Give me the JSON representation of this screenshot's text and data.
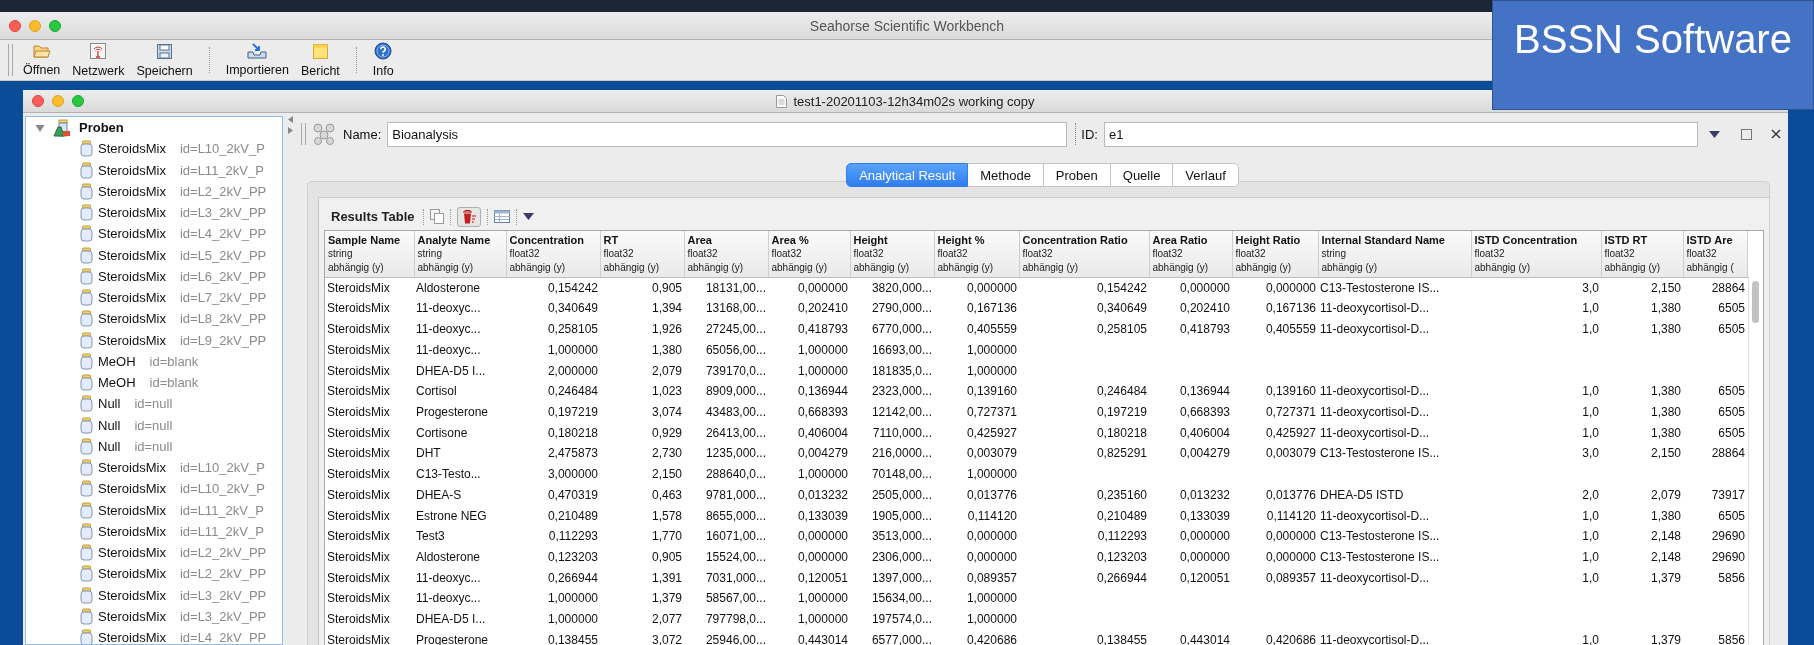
{
  "window": {
    "title": "Seahorse Scientific Workbench"
  },
  "toolbar": {
    "groups": [
      [
        {
          "label": "Öffnen",
          "kind": "folder"
        },
        {
          "label": "Netzwerk",
          "kind": "antenna"
        },
        {
          "label": "Speichern",
          "kind": "floppy"
        }
      ],
      [
        {
          "label": "Importieren",
          "kind": "import"
        },
        {
          "label": "Bericht",
          "kind": "note"
        }
      ],
      [
        {
          "label": "Info",
          "kind": "help"
        }
      ]
    ]
  },
  "document": {
    "title": "test1-20201103-12h34m02s working copy"
  },
  "tree": {
    "label": "Proben",
    "expanded": true,
    "children": [
      {
        "name": "SteroidsMix",
        "id": "id=L10_2kV_P"
      },
      {
        "name": "SteroidsMix",
        "id": "id=L11_2kV_P"
      },
      {
        "name": "SteroidsMix",
        "id": "id=L2_2kV_PP"
      },
      {
        "name": "SteroidsMix",
        "id": "id=L3_2kV_PP"
      },
      {
        "name": "SteroidsMix",
        "id": "id=L4_2kV_PP"
      },
      {
        "name": "SteroidsMix",
        "id": "id=L5_2kV_PP"
      },
      {
        "name": "SteroidsMix",
        "id": "id=L6_2kV_PP"
      },
      {
        "name": "SteroidsMix",
        "id": "id=L7_2kV_PP"
      },
      {
        "name": "SteroidsMix",
        "id": "id=L8_2kV_PP"
      },
      {
        "name": "SteroidsMix",
        "id": "id=L9_2kV_PP"
      },
      {
        "name": "MeOH",
        "id": "id=blank"
      },
      {
        "name": "MeOH",
        "id": "id=blank"
      },
      {
        "name": "Null",
        "id": "id=null"
      },
      {
        "name": "Null",
        "id": "id=null"
      },
      {
        "name": "Null",
        "id": "id=null"
      },
      {
        "name": "SteroidsMix",
        "id": "id=L10_2kV_P"
      },
      {
        "name": "SteroidsMix",
        "id": "id=L10_2kV_P"
      },
      {
        "name": "SteroidsMix",
        "id": "id=L11_2kV_P"
      },
      {
        "name": "SteroidsMix",
        "id": "id=L11_2kV_P"
      },
      {
        "name": "SteroidsMix",
        "id": "id=L2_2kV_PP"
      },
      {
        "name": "SteroidsMix",
        "id": "id=L2_2kV_PP"
      },
      {
        "name": "SteroidsMix",
        "id": "id=L3_2kV_PP"
      },
      {
        "name": "SteroidsMix",
        "id": "id=L3_2kV_PP"
      },
      {
        "name": "SteroidsMix",
        "id": "id=L4_2kV_PP"
      }
    ]
  },
  "editor": {
    "name_label": "Name:",
    "name_value": "Bioanalysis",
    "id_label": "ID:",
    "id_value": "e1"
  },
  "tabs": [
    {
      "label": "Analytical Result",
      "selected": true
    },
    {
      "label": "Methode",
      "selected": false
    },
    {
      "label": "Proben",
      "selected": false
    },
    {
      "label": "Quelle",
      "selected": false
    },
    {
      "label": "Verlauf",
      "selected": false
    }
  ],
  "results": {
    "title": "Results Table",
    "columns": [
      {
        "name": "Sample Name",
        "type": "string",
        "role": "abhängig (y)"
      },
      {
        "name": "Analyte Name",
        "type": "string",
        "role": "abhängig (y)"
      },
      {
        "name": "Concentration",
        "type": "float32",
        "role": "abhängig (y)"
      },
      {
        "name": "RT",
        "type": "float32",
        "role": "abhängig (y)"
      },
      {
        "name": "Area",
        "type": "float32",
        "role": "abhängig (y)"
      },
      {
        "name": "Area %",
        "type": "float32",
        "role": "abhängig (y)"
      },
      {
        "name": "Height",
        "type": "float32",
        "role": "abhängig (y)"
      },
      {
        "name": "Height %",
        "type": "float32",
        "role": "abhängig (y)"
      },
      {
        "name": "Concentration Ratio",
        "type": "float32",
        "role": "abhängig (y)"
      },
      {
        "name": "Area Ratio",
        "type": "float32",
        "role": "abhängig (y)"
      },
      {
        "name": "Height Ratio",
        "type": "float32",
        "role": "abhängig (y)"
      },
      {
        "name": "Internal Standard Name",
        "type": "string",
        "role": "abhängig (y)"
      },
      {
        "name": "ISTD Concentration",
        "type": "float32",
        "role": "abhängig (y)"
      },
      {
        "name": "ISTD RT",
        "type": "float32",
        "role": "abhängig (y)"
      },
      {
        "name": "ISTD Are",
        "type": "float32",
        "role": "abhängig ("
      }
    ],
    "rows": [
      [
        "SteroidsMix",
        "Aldosterone",
        "0,154242",
        "0,905",
        "18131,00...",
        "0,000000",
        "3820,000...",
        "0,000000",
        "0,154242",
        "0,000000",
        "0,000000",
        "C13-Testosterone IS...",
        "3,0",
        "2,150",
        "28864"
      ],
      [
        "SteroidsMix",
        "11-deoxyc...",
        "0,340649",
        "1,394",
        "13168,00...",
        "0,202410",
        "2790,000...",
        "0,167136",
        "0,340649",
        "0,202410",
        "0,167136",
        "11-deoxycortisol-D...",
        "1,0",
        "1,380",
        "6505"
      ],
      [
        "SteroidsMix",
        "11-deoxyc...",
        "0,258105",
        "1,926",
        "27245,00...",
        "0,418793",
        "6770,000...",
        "0,405559",
        "0,258105",
        "0,418793",
        "0,405559",
        "11-deoxycortisol-D...",
        "1,0",
        "1,380",
        "6505"
      ],
      [
        "SteroidsMix",
        "11-deoxyc...",
        "1,000000",
        "1,380",
        "65056,00...",
        "1,000000",
        "16693,00...",
        "1,000000"
      ],
      [
        "SteroidsMix",
        "DHEA-D5 I...",
        "2,000000",
        "2,079",
        "739170,0...",
        "1,000000",
        "181835,0...",
        "1,000000"
      ],
      [
        "SteroidsMix",
        "Cortisol",
        "0,246484",
        "1,023",
        "8909,000...",
        "0,136944",
        "2323,000...",
        "0,139160",
        "0,246484",
        "0,136944",
        "0,139160",
        "11-deoxycortisol-D...",
        "1,0",
        "1,380",
        "6505"
      ],
      [
        "SteroidsMix",
        "Progesterone",
        "0,197219",
        "3,074",
        "43483,00...",
        "0,668393",
        "12142,00...",
        "0,727371",
        "0,197219",
        "0,668393",
        "0,727371",
        "11-deoxycortisol-D...",
        "1,0",
        "1,380",
        "6505"
      ],
      [
        "SteroidsMix",
        "Cortisone",
        "0,180218",
        "0,929",
        "26413,00...",
        "0,406004",
        "7110,000...",
        "0,425927",
        "0,180218",
        "0,406004",
        "0,425927",
        "11-deoxycortisol-D...",
        "1,0",
        "1,380",
        "6505"
      ],
      [
        "SteroidsMix",
        "DHT",
        "2,475873",
        "2,730",
        "1235,000...",
        "0,004279",
        "216,0000...",
        "0,003079",
        "0,825291",
        "0,004279",
        "0,003079",
        "C13-Testosterone IS...",
        "3,0",
        "2,150",
        "28864"
      ],
      [
        "SteroidsMix",
        "C13-Testo...",
        "3,000000",
        "2,150",
        "288640,0...",
        "1,000000",
        "70148,00...",
        "1,000000"
      ],
      [
        "SteroidsMix",
        "DHEA-S",
        "0,470319",
        "0,463",
        "9781,000...",
        "0,013232",
        "2505,000...",
        "0,013776",
        "0,235160",
        "0,013232",
        "0,013776",
        "DHEA-D5 ISTD",
        "2,0",
        "2,079",
        "73917"
      ],
      [
        "SteroidsMix",
        "Estrone NEG",
        "0,210489",
        "1,578",
        "8655,000...",
        "0,133039",
        "1905,000...",
        "0,114120",
        "0,210489",
        "0,133039",
        "0,114120",
        "11-deoxycortisol-D...",
        "1,0",
        "1,380",
        "6505"
      ],
      [
        "SteroidsMix",
        "Test3",
        "0,112293",
        "1,770",
        "16071,00...",
        "0,000000",
        "3513,000...",
        "0,000000",
        "0,112293",
        "0,000000",
        "0,000000",
        "C13-Testosterone IS...",
        "1,0",
        "2,148",
        "29690"
      ],
      [
        "SteroidsMix",
        "Aldosterone",
        "0,123203",
        "0,905",
        "15524,00...",
        "0,000000",
        "2306,000...",
        "0,000000",
        "0,123203",
        "0,000000",
        "0,000000",
        "C13-Testosterone IS...",
        "1,0",
        "2,148",
        "29690"
      ],
      [
        "SteroidsMix",
        "11-deoxyc...",
        "0,266944",
        "1,391",
        "7031,000...",
        "0,120051",
        "1397,000...",
        "0,089357",
        "0,266944",
        "0,120051",
        "0,089357",
        "11-deoxycortisol-D...",
        "1,0",
        "1,379",
        "5856"
      ],
      [
        "SteroidsMix",
        "11-deoxyc...",
        "1,000000",
        "1,379",
        "58567,00...",
        "1,000000",
        "15634,00...",
        "1,000000"
      ],
      [
        "SteroidsMix",
        "DHEA-D5 I...",
        "1,000000",
        "2,077",
        "797798,0...",
        "1,000000",
        "197574,0...",
        "1,000000"
      ],
      [
        "SteroidsMix",
        "Progesterone",
        "0,138455",
        "3,072",
        "25946,00...",
        "0,443014",
        "6577,000...",
        "0,420686",
        "0,138455",
        "0,443014",
        "0,420686",
        "11-deoxycortisol-D...",
        "1,0",
        "1,379",
        "5856"
      ]
    ]
  },
  "banner": {
    "text": "BSSN Software"
  }
}
